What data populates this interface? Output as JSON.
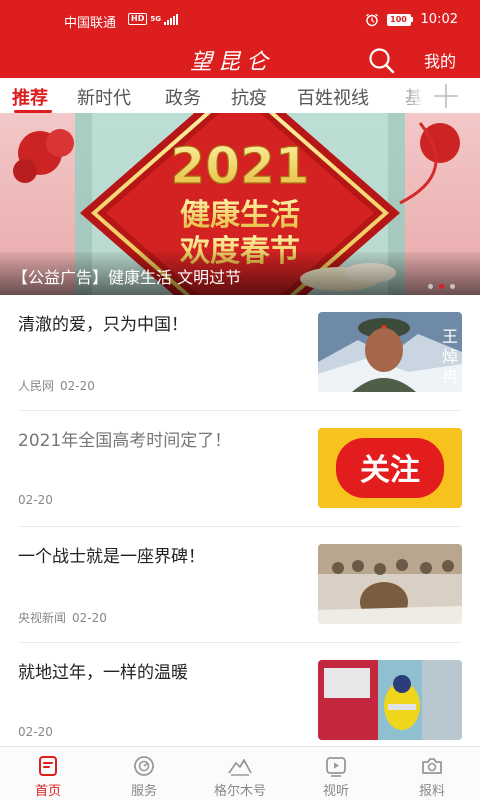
{
  "status_bar": {
    "carrier": "中国联通",
    "hd": "HD",
    "network": "5G",
    "battery": "100",
    "time": "10:02",
    "icons": [
      "hd-badge",
      "5g-icon",
      "signal-icon",
      "alarm-icon",
      "battery-icon"
    ]
  },
  "header": {
    "logo": "望昆仑",
    "mine_label": "我的",
    "icons": [
      "search-icon"
    ]
  },
  "tabs": [
    {
      "label": "推荐",
      "active": true
    },
    {
      "label": "新时代",
      "active": false
    },
    {
      "label": "政务",
      "active": false
    },
    {
      "label": "抗疫",
      "active": false
    },
    {
      "label": "百姓视线",
      "active": false
    },
    {
      "label": "基",
      "active": false
    }
  ],
  "tabs_more_icon": "plus-icon",
  "banner": {
    "year": "2021",
    "line1": "健康生活",
    "line2": "欢度春节",
    "caption": "【公益广告】健康生活 文明过节",
    "slides": 3,
    "active_slide": 2
  },
  "feed": [
    {
      "title": "清澈的爱，只为中国！",
      "source": "人民网",
      "date": "02-20",
      "read": false,
      "thumb": "soldier-portrait"
    },
    {
      "title": "2021年全国高考时间定了！",
      "source": "",
      "date": "02-20",
      "read": true,
      "thumb": "follow-banner",
      "thumb_text": "关注"
    },
    {
      "title": "一个战士就是一座界碑！",
      "source": "央视新闻",
      "date": "02-20",
      "read": false,
      "thumb": "soldiers-snow"
    },
    {
      "title": "就地过年，一样的温暖",
      "source": "",
      "date": "02-20",
      "read": false,
      "thumb": "officer-truck"
    }
  ],
  "bottom_nav": [
    {
      "label": "首页",
      "icon": "home-icon",
      "active": true
    },
    {
      "label": "服务",
      "icon": "service-icon",
      "active": false
    },
    {
      "label": "格尔木号",
      "icon": "mountain-icon",
      "active": false
    },
    {
      "label": "视听",
      "icon": "video-icon",
      "active": false
    },
    {
      "label": "报料",
      "icon": "camera-icon",
      "active": false
    }
  ],
  "colors": {
    "brand": "#dd1e1e",
    "text": "#222222",
    "muted": "#888888"
  }
}
